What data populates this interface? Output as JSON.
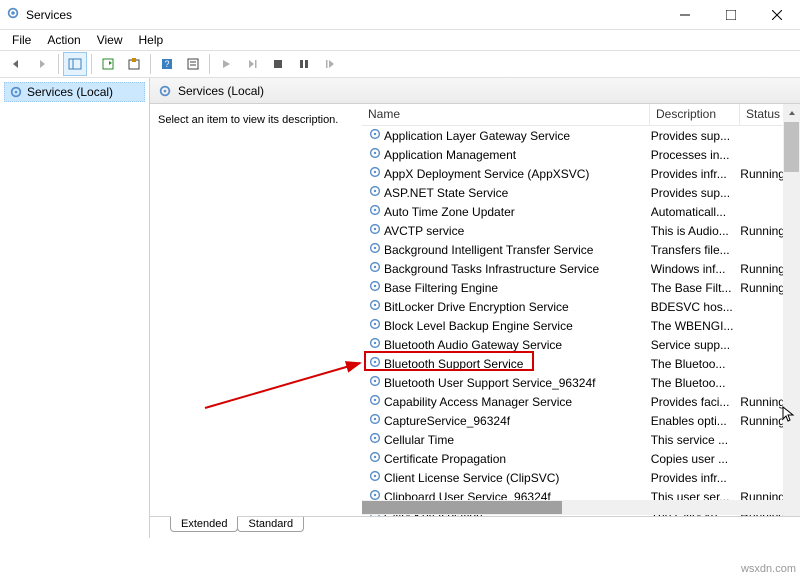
{
  "window": {
    "title": "Services"
  },
  "menu": {
    "file": "File",
    "action": "Action",
    "view": "View",
    "help": "Help"
  },
  "sidebar": {
    "root": "Services (Local)"
  },
  "content": {
    "header": "Services (Local)",
    "description_prompt": "Select an item to view its description.",
    "columns": {
      "name": "Name",
      "description": "Description",
      "status": "Status"
    }
  },
  "tabs": {
    "extended": "Extended",
    "standard": "Standard"
  },
  "services": [
    {
      "name": "Application Layer Gateway Service",
      "desc": "Provides sup...",
      "status": ""
    },
    {
      "name": "Application Management",
      "desc": "Processes in...",
      "status": ""
    },
    {
      "name": "AppX Deployment Service (AppXSVC)",
      "desc": "Provides infr...",
      "status": "Running"
    },
    {
      "name": "ASP.NET State Service",
      "desc": "Provides sup...",
      "status": ""
    },
    {
      "name": "Auto Time Zone Updater",
      "desc": "Automaticall...",
      "status": ""
    },
    {
      "name": "AVCTP service",
      "desc": "This is Audio...",
      "status": "Running"
    },
    {
      "name": "Background Intelligent Transfer Service",
      "desc": "Transfers file...",
      "status": ""
    },
    {
      "name": "Background Tasks Infrastructure Service",
      "desc": "Windows inf...",
      "status": "Running"
    },
    {
      "name": "Base Filtering Engine",
      "desc": "The Base Filt...",
      "status": "Running"
    },
    {
      "name": "BitLocker Drive Encryption Service",
      "desc": "BDESVC hos...",
      "status": ""
    },
    {
      "name": "Block Level Backup Engine Service",
      "desc": "The WBENGI...",
      "status": ""
    },
    {
      "name": "Bluetooth Audio Gateway Service",
      "desc": "Service supp...",
      "status": ""
    },
    {
      "name": "Bluetooth Support Service",
      "desc": "The Bluetoo...",
      "status": ""
    },
    {
      "name": "Bluetooth User Support Service_96324f",
      "desc": "The Bluetoo...",
      "status": ""
    },
    {
      "name": "Capability Access Manager Service",
      "desc": "Provides faci...",
      "status": "Running"
    },
    {
      "name": "CaptureService_96324f",
      "desc": "Enables opti...",
      "status": "Running"
    },
    {
      "name": "Cellular Time",
      "desc": "This service ...",
      "status": ""
    },
    {
      "name": "Certificate Propagation",
      "desc": "Copies user ...",
      "status": ""
    },
    {
      "name": "Client License Service (ClipSVC)",
      "desc": "Provides infr...",
      "status": ""
    },
    {
      "name": "Clipboard User Service_96324f",
      "desc": "This user ser...",
      "status": "Running"
    },
    {
      "name": "CNG Key Isolation",
      "desc": "The CNG ke...",
      "status": "Running"
    }
  ],
  "watermark": "wsxdn.com"
}
